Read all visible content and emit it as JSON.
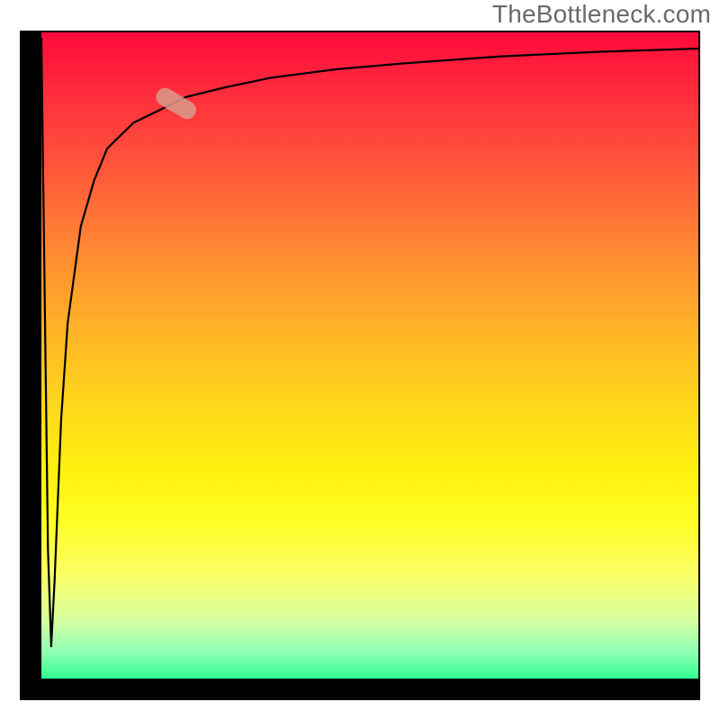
{
  "watermark": "TheBottleneck.com",
  "frame": {
    "border_color": "#000000"
  },
  "chart_data": {
    "type": "line",
    "title": "",
    "xlabel": "",
    "ylabel": "",
    "xlim": [
      0,
      100
    ],
    "ylim": [
      0,
      100
    ],
    "grid": false,
    "legend": "none",
    "series": [
      {
        "name": "curve",
        "x": [
          0,
          0.5,
          1,
          1.5,
          2,
          3,
          4,
          6,
          8,
          10,
          14,
          18,
          22,
          28,
          35,
          45,
          55,
          70,
          85,
          100
        ],
        "y": [
          99,
          60,
          20,
          5,
          15,
          40,
          55,
          70,
          77,
          82,
          86,
          88,
          90,
          91.5,
          93,
          94.3,
          95.2,
          96.3,
          97,
          97.5
        ]
      }
    ],
    "annotations": [
      {
        "name": "highlight-pill",
        "x_range": [
          18,
          23
        ],
        "y_range": [
          87.5,
          90.5
        ]
      }
    ],
    "background_gradient": {
      "direction": "vertical",
      "stops": [
        {
          "pos": 0,
          "color": "#ff0a3a"
        },
        {
          "pos": 34,
          "color": "#ff8a32"
        },
        {
          "pos": 68,
          "color": "#fff10f"
        },
        {
          "pos": 91,
          "color": "#d6ffa0"
        },
        {
          "pos": 100,
          "color": "#2fff90"
        }
      ]
    }
  }
}
